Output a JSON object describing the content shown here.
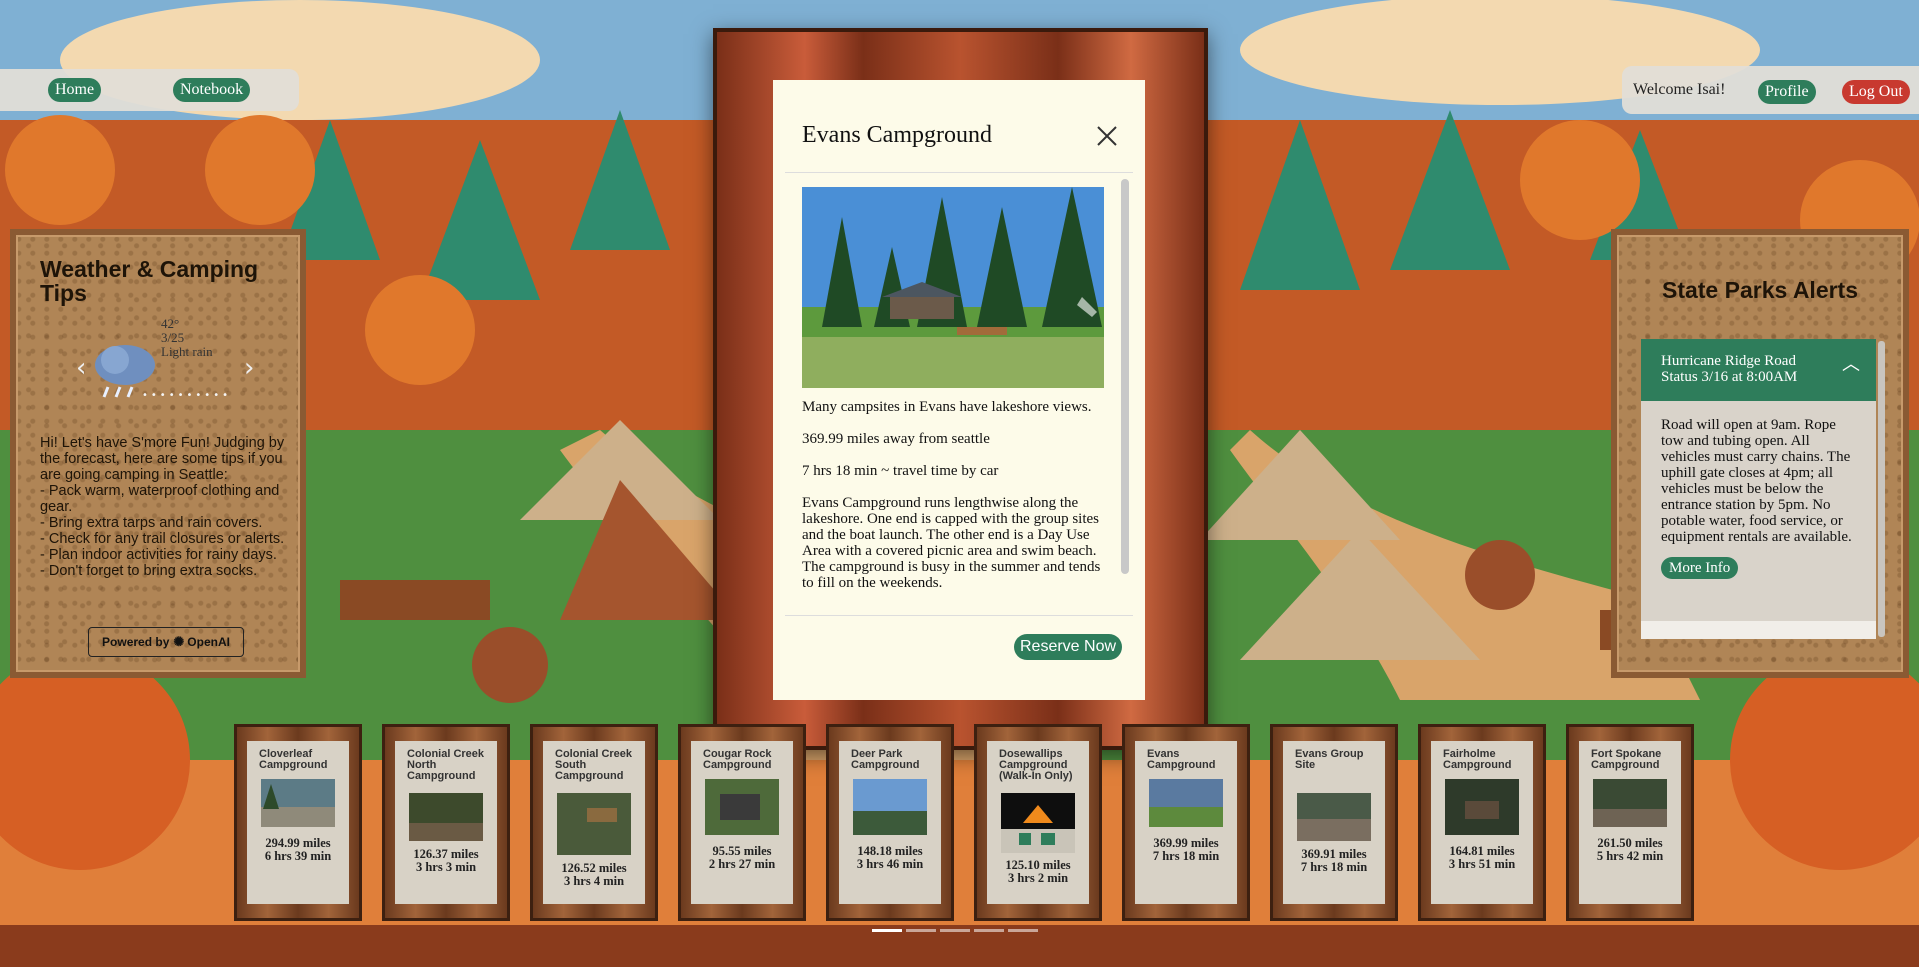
{
  "nav": {
    "home_label": "Home",
    "notebook_label": "Notebook"
  },
  "user": {
    "welcome": "Welcome Isai!",
    "profile_label": "Profile",
    "logout_label": "Log Out"
  },
  "weather": {
    "title": "Weather & Camping Tips",
    "temp": "42°",
    "date": "3/25",
    "condition": "Light rain",
    "icon": "rain-cloud-icon",
    "tips": [
      "Hi! Let's have S'more Fun! Judging by the forecast, here are some tips if you are going camping in Seattle:",
      "- Pack warm, waterproof clothing and gear.",
      "- Bring extra tarps and rain covers.",
      "- Check for any trail closures or alerts.",
      "- Plan indoor activities for rainy days.",
      "- Don't forget to bring extra socks."
    ],
    "powered_by": "Powered by",
    "powered_brand": "OpenAI"
  },
  "alerts": {
    "title": "State Parks Alerts",
    "item_title": "Hurricane Ridge Road Status 3/16 at 8:00AM",
    "item_body": "Road will open at 9am. Rope tow and tubing open. All vehicles must carry chains. The uphill gate closes at 4pm; all vehicles must be below the entrance station by 5pm. No potable water, food service, or equipment rentals are available.",
    "more_info_label": "More Info"
  },
  "modal": {
    "title": "Evans Campground",
    "summary": "Many campsites in Evans have lakeshore views.",
    "distance": "369.99 miles away from seattle",
    "travel": "7 hrs 18 min ~ travel time by car",
    "description": "Evans Campground runs lengthwise along the lakeshore. One end is capped with the group sites and the boat launch. The other end is a Day Use Area with a covered picnic area and swim beach. The campground is busy in the summer and tends to fill on the weekends.",
    "reserve_label": "Reserve Now"
  },
  "campgrounds": [
    {
      "name": "Cloverleaf Campground",
      "miles": "294.99 miles",
      "time": "6 hrs 39 min"
    },
    {
      "name": "Colonial Creek North Campground",
      "miles": "126.37 miles",
      "time": "3 hrs 3 min"
    },
    {
      "name": "Colonial Creek South Campground",
      "miles": "126.52 miles",
      "time": "3 hrs 4 min"
    },
    {
      "name": "Cougar Rock Campground",
      "miles": "95.55 miles",
      "time": "2 hrs 27 min"
    },
    {
      "name": "Deer Park Campground",
      "miles": "148.18 miles",
      "time": "3 hrs 46 min"
    },
    {
      "name": "Dosewallips Campground (Walk-In Only)",
      "miles": "125.10 miles",
      "time": "3 hrs 2 min"
    },
    {
      "name": "Evans Campground",
      "miles": "369.99 miles",
      "time": "7 hrs 18 min"
    },
    {
      "name": "Evans Group Site",
      "miles": "369.91 miles",
      "time": "7 hrs 18 min"
    },
    {
      "name": "Fairholme Campground",
      "miles": "164.81 miles",
      "time": "3 hrs 51 min"
    },
    {
      "name": "Fort Spokane Campground",
      "miles": "261.50 miles",
      "time": "5 hrs 42 min"
    }
  ],
  "colors": {
    "accent": "#2e7d5b",
    "logout": "#c8392f",
    "cork": "#b08556"
  }
}
